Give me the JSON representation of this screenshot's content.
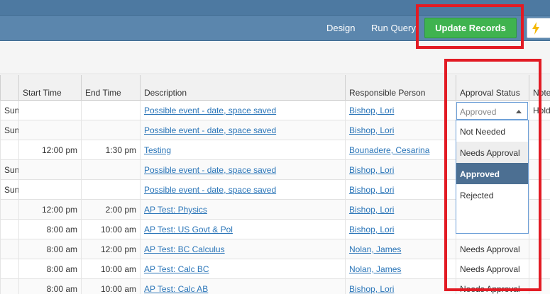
{
  "toolbar": {
    "design": "Design",
    "run_query": "Run Query",
    "update_records": "Update Records",
    "bolt_icon": "lightning-bolt-icon",
    "bolt_color": "#f5b800"
  },
  "columns": [
    "",
    "Start Time",
    "End Time",
    "Description",
    "Responsible Person",
    "Approval Status",
    "Note"
  ],
  "rows": [
    {
      "day": "Sun)",
      "start": "",
      "end": "",
      "desc": "Possible event - date, space saved",
      "person": "Bishop, Lori",
      "status": "",
      "note": "Hold"
    },
    {
      "day": "Sun)",
      "start": "",
      "end": "",
      "desc": "Possible event - date, space saved",
      "person": "Bishop, Lori",
      "status": "",
      "note": ""
    },
    {
      "day": "",
      "start": "12:00 pm",
      "end": "1:30 pm",
      "desc": "Testing",
      "person": "Bounadere, Cesarina",
      "status": "",
      "note": ""
    },
    {
      "day": "Sun)",
      "start": "",
      "end": "",
      "desc": "Possible event - date, space saved",
      "person": "Bishop, Lori",
      "status": "",
      "note": ""
    },
    {
      "day": "Sun)",
      "start": "",
      "end": "",
      "desc": "Possible event - date, space saved",
      "person": "Bishop, Lori",
      "status": "",
      "note": ""
    },
    {
      "day": "",
      "start": "12:00 pm",
      "end": "2:00 pm",
      "desc": "AP Test: Physics",
      "person": "Bishop, Lori",
      "status": "",
      "note": ""
    },
    {
      "day": "",
      "start": "8:00 am",
      "end": "10:00 am",
      "desc": "AP Test: US Govt & Pol",
      "person": "Bishop, Lori",
      "status": "",
      "note": ""
    },
    {
      "day": "",
      "start": "8:00 am",
      "end": "12:00 pm",
      "desc": "AP Test: BC Calculus",
      "person": "Nolan, James",
      "status": "Needs Approval",
      "note": ""
    },
    {
      "day": "",
      "start": "8:00 am",
      "end": "10:00 am",
      "desc": "AP Test: Calc BC",
      "person": "Nolan, James",
      "status": "Needs Approval",
      "note": ""
    },
    {
      "day": "",
      "start": "8:00 am",
      "end": "10:00 am",
      "desc": "AP Test: Calc AB",
      "person": "Bishop, Lori",
      "status": "Needs Approval",
      "note": ""
    }
  ],
  "status_select": {
    "value": "Approved",
    "options": [
      "Not Needed",
      "Needs Approval",
      "Approved",
      "Rejected"
    ],
    "hovered": "Needs Approval",
    "selected": "Approved"
  },
  "colors": {
    "accent": "#4c6f92",
    "update_button": "#3fb34f",
    "link": "#2a75b8",
    "annotation": "#e21b24"
  }
}
